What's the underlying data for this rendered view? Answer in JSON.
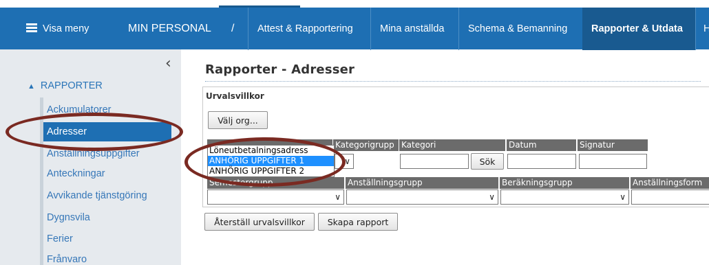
{
  "topnav": {
    "menu_label": "Visa meny",
    "brand": "MIN PERSONAL",
    "separator": "/",
    "items": [
      "Attest & Rapportering",
      "Mina anställda",
      "Schema & Bemanning",
      "Rapporter & Utdata",
      "H"
    ],
    "active_index": 3
  },
  "sidebar": {
    "collapse_glyph": "‹",
    "section": "RAPPORTER",
    "items": [
      "Ackumulatorer",
      "Adresser",
      "Anställningsuppgifter",
      "Anteckningar",
      "Avvikande tjänstgöring",
      "Dygnsvila",
      "Ferier",
      "Frånvaro"
    ],
    "active_index": 1
  },
  "main": {
    "title": "Rapporter - Adresser",
    "panel_title": "Urvalsvillkor",
    "select_org_button": "Välj org...",
    "row1_headers": [
      "",
      "Kategorigrupp",
      "Kategori",
      "Datum",
      "Signatur"
    ],
    "search_button": "Sök",
    "row2_headers": [
      "Semestergrupp",
      "Anställningsgrupp",
      "Beräkningsgrupp",
      "Anställningsform"
    ],
    "reset_button": "Återställ urvalsvillkor",
    "create_button": "Skapa rapport",
    "dropdown_options": [
      "Löneutbetalningsadress",
      "ANHÖRIG UPPGIFTER 1",
      "ANHÖRIG UPPGIFTER 2"
    ],
    "dropdown_selected_index": 1
  },
  "colors": {
    "nav_bg": "#1e6fb3",
    "nav_active": "#195a90",
    "sidebar_bg": "#e6eaee",
    "link": "#3677b8",
    "header_cell": "#6b6b6b",
    "annotation": "#7a2a22"
  }
}
